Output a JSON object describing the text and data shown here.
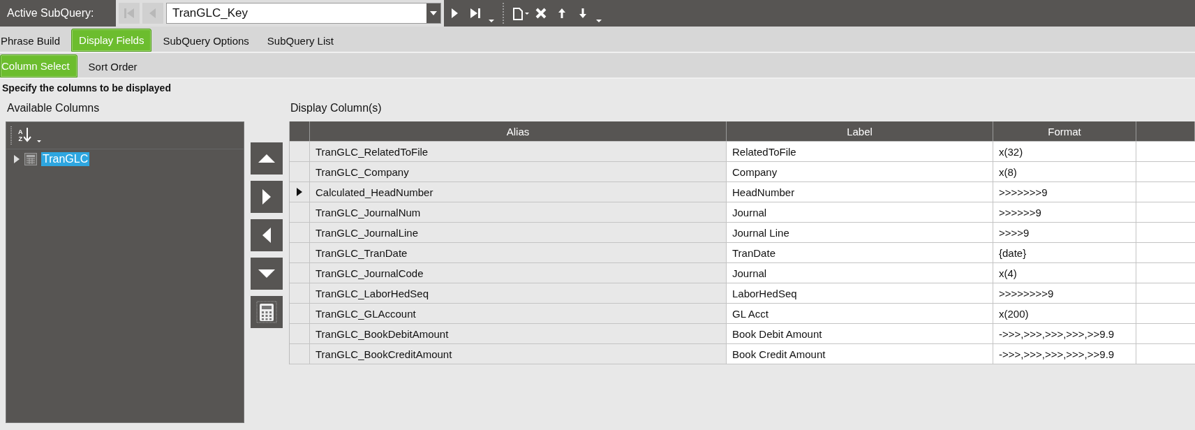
{
  "toolbar": {
    "label": "Active SubQuery:",
    "lead_buttons": [
      {
        "kind": "first",
        "disabled": true
      },
      {
        "kind": "prev",
        "disabled": true
      }
    ],
    "subquery_field": {
      "value": "TranGLC_Key"
    },
    "trail_buttons": [
      {
        "kind": "next"
      },
      {
        "kind": "last"
      },
      {
        "kind": "more"
      },
      {
        "kind": "separator"
      },
      {
        "kind": "new"
      },
      {
        "kind": "delete"
      },
      {
        "kind": "up"
      },
      {
        "kind": "down"
      },
      {
        "kind": "more"
      }
    ]
  },
  "tabs": [
    {
      "label": "Phrase Build",
      "selected": false
    },
    {
      "label": "Display Fields",
      "selected": true
    },
    {
      "label": "SubQuery Options",
      "selected": false
    },
    {
      "label": "SubQuery List",
      "selected": false
    }
  ],
  "subtabs": [
    {
      "label": "Column Select",
      "selected": true
    },
    {
      "label": "Sort Order",
      "selected": false
    }
  ],
  "instruction": "Specify the columns to be displayed",
  "available_columns": {
    "title": "Available Columns",
    "sort_letters": [
      "A",
      "Z"
    ],
    "tree": [
      {
        "label": "TranGLC",
        "expanded": false,
        "selected": true
      }
    ]
  },
  "move_buttons": [
    {
      "kind": "up"
    },
    {
      "kind": "right"
    },
    {
      "kind": "left"
    },
    {
      "kind": "down"
    },
    {
      "kind": "calculator"
    }
  ],
  "display_columns": {
    "title": "Display Column(s)",
    "columns": [
      "Alias",
      "Label",
      "Format"
    ],
    "rows": [
      {
        "current": false,
        "cells": [
          "TranGLC_RelatedToFile",
          "RelatedToFile",
          "x(32)"
        ]
      },
      {
        "current": false,
        "cells": [
          "TranGLC_Company",
          "Company",
          "x(8)"
        ]
      },
      {
        "current": true,
        "cells": [
          "Calculated_HeadNumber",
          "HeadNumber",
          ">>>>>>>9"
        ]
      },
      {
        "current": false,
        "cells": [
          "TranGLC_JournalNum",
          "Journal",
          ">>>>>>9"
        ]
      },
      {
        "current": false,
        "cells": [
          "TranGLC_JournalLine",
          "Journal Line",
          ">>>>9"
        ]
      },
      {
        "current": false,
        "cells": [
          "TranGLC_TranDate",
          "TranDate",
          "{date}"
        ]
      },
      {
        "current": false,
        "cells": [
          "TranGLC_JournalCode",
          "Journal",
          "x(4)"
        ]
      },
      {
        "current": false,
        "cells": [
          "TranGLC_LaborHedSeq",
          "LaborHedSeq",
          ">>>>>>>>9"
        ]
      },
      {
        "current": false,
        "cells": [
          "TranGLC_GLAccount",
          "GL Acct",
          "x(200)"
        ]
      },
      {
        "current": false,
        "cells": [
          "TranGLC_BookDebitAmount",
          "Book Debit Amount",
          "->>>,>>>,>>>,>>>,>>9.9"
        ]
      },
      {
        "current": false,
        "cells": [
          "TranGLC_BookCreditAmount",
          "Book Credit Amount",
          "->>>,>>>,>>>,>>>,>>9.9"
        ]
      }
    ]
  }
}
